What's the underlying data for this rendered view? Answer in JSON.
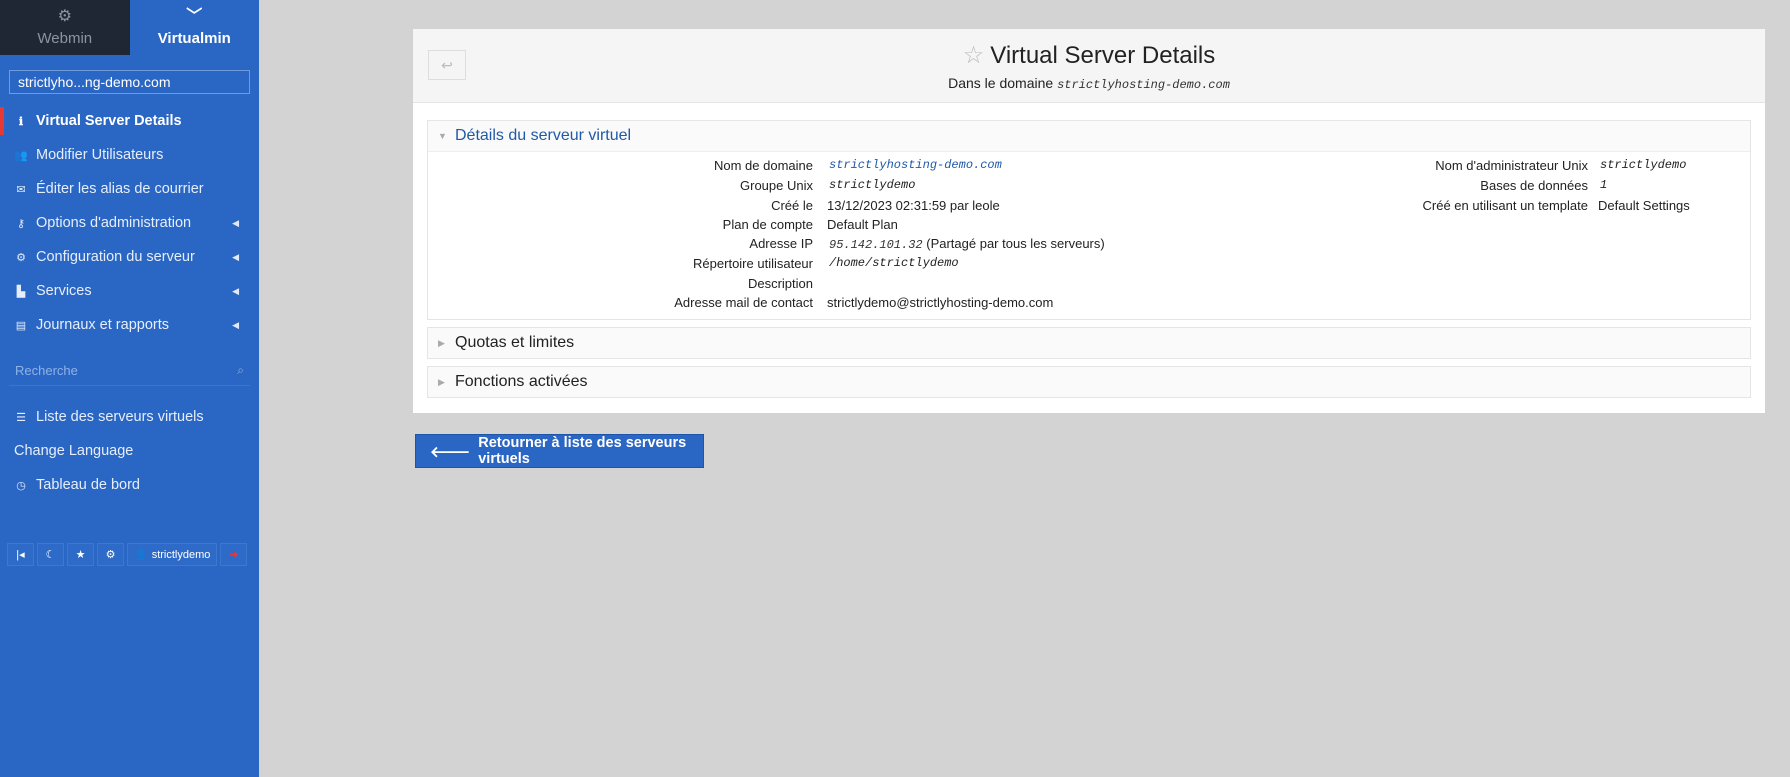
{
  "switcher": {
    "webmin_label": "Webmin",
    "virtualmin_label": "Virtualmin"
  },
  "sidebar": {
    "domain_selected": "strictlyho...ng-demo.com",
    "menu": [
      {
        "label": "Virtual Server Details",
        "icon": "info-icon",
        "active": true
      },
      {
        "label": "Modifier Utilisateurs",
        "icon": "users-icon"
      },
      {
        "label": "Éditer les alias de courrier",
        "icon": "envelope-icon"
      },
      {
        "label": "Options d'administration",
        "icon": "key-icon",
        "submenu": true
      },
      {
        "label": "Configuration du serveur",
        "icon": "gears-icon",
        "submenu": true
      },
      {
        "label": "Services",
        "icon": "puzzle-icon",
        "submenu": true
      },
      {
        "label": "Journaux et rapports",
        "icon": "document-icon",
        "submenu": true
      }
    ],
    "search_placeholder": "Recherche",
    "links": [
      {
        "label": "Liste des serveurs virtuels",
        "icon": "list-icon"
      },
      {
        "label": "Change Language",
        "icon": ""
      },
      {
        "label": "Tableau de bord",
        "icon": "dashboard-icon"
      }
    ],
    "bottom": {
      "user_label": "strictlydemo"
    }
  },
  "header": {
    "title": "Virtual Server Details",
    "subtitle_prefix": "Dans le domaine",
    "subtitle_domain": "strictlyhosting-demo.com"
  },
  "details_section": {
    "title": "Détails du serveur virtuel",
    "left_fields": [
      {
        "label": "Nom de domaine",
        "value": "strictlyhosting-demo.com",
        "style": "mono-link"
      },
      {
        "label": "Groupe Unix",
        "value": "strictlydemo",
        "style": "mono"
      },
      {
        "label": "Créé le",
        "value": "13/12/2023 02:31:59 par leole",
        "style": "plain"
      },
      {
        "label": "Plan de compte",
        "value": "Default Plan",
        "style": "plain"
      },
      {
        "label": "Adresse IP",
        "value": "95.142.101.32",
        "value_suffix": "(Partagé par tous les serveurs)",
        "style": "mono"
      },
      {
        "label": "Répertoire utilisateur",
        "value": "/home/strictlydemo",
        "style": "mono"
      },
      {
        "label": "Description",
        "value": "",
        "style": "plain"
      },
      {
        "label": "Adresse mail de contact",
        "value": "strictlydemo@strictlyhosting-demo.com",
        "style": "plain"
      }
    ],
    "right_fields": [
      {
        "label": "Nom d'administrateur Unix",
        "value": "strictlydemo",
        "style": "mono"
      },
      {
        "label": "Bases de données",
        "value": "1",
        "style": "mono"
      },
      {
        "label": "Créé en utilisant un template",
        "value": "Default Settings",
        "style": "plain"
      }
    ]
  },
  "collapsed_sections": [
    {
      "title": "Quotas et limites"
    },
    {
      "title": "Fonctions activées"
    }
  ],
  "return_button": {
    "label": "Retourner à liste des serveurs virtuels"
  },
  "colors": {
    "sidebar_bg": "#2a66c3",
    "active_marker": "#e53935",
    "link": "#1f5aa8",
    "page_bg": "#d3d3d3"
  }
}
